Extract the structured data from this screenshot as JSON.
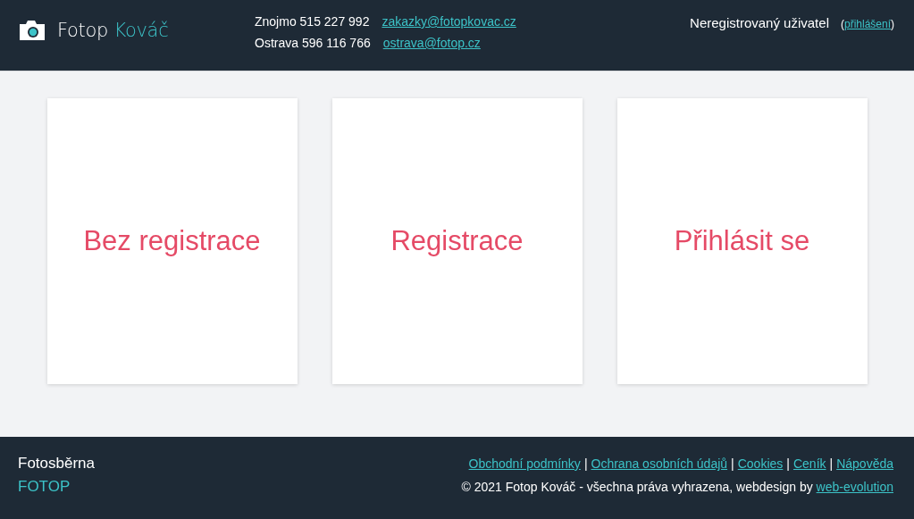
{
  "header": {
    "logo": {
      "first": "Fotop",
      "second": "Kováč"
    },
    "contacts": [
      {
        "label": "Znojmo 515 227 992",
        "email": "zakazky@fotopkovac.cz"
      },
      {
        "label": "Ostrava 596 116 766",
        "email": "ostrava@fotop.cz"
      }
    ],
    "user": {
      "name": "Neregistrovaný uživatel",
      "before": "(",
      "link": "přihlášení",
      "after": ")"
    }
  },
  "cards": [
    {
      "label": "Bez registrace"
    },
    {
      "label": "Registrace"
    },
    {
      "label": "Přihlásit se"
    }
  ],
  "footer": {
    "title": "Fotosběrna",
    "brand": "FOTOP",
    "links": [
      {
        "label": "Obchodní podmínky"
      },
      {
        "label": "Ochrana osobních údajů"
      },
      {
        "label": "Cookies"
      },
      {
        "label": "Ceník"
      },
      {
        "label": "Nápověda"
      }
    ],
    "separator": "|",
    "copyright": {
      "text": "© 2021 Fotop Kováč - všechna práva vyhrazena, webdesign by",
      "link": "web-evolution"
    }
  }
}
